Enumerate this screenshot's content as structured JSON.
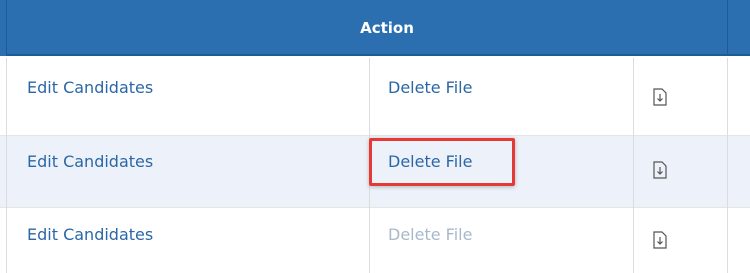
{
  "table": {
    "header": {
      "action_label": "Action"
    },
    "rows": [
      {
        "edit_label": "Edit Candidates",
        "delete_label": "Delete File",
        "delete_enabled": true
      },
      {
        "edit_label": "Edit Candidates",
        "delete_label": "Delete File",
        "delete_enabled": true,
        "highlighted": true
      },
      {
        "edit_label": "Edit Candidates",
        "delete_label": "Delete File",
        "delete_enabled": false
      }
    ],
    "row_icon": "file-download-icon"
  },
  "colors": {
    "header_bg": "#2c6fb0",
    "link": "#2b67a6",
    "link_disabled": "#a9b9cb",
    "row_alt_bg": "#edf2fa",
    "highlight": "#e53935"
  }
}
